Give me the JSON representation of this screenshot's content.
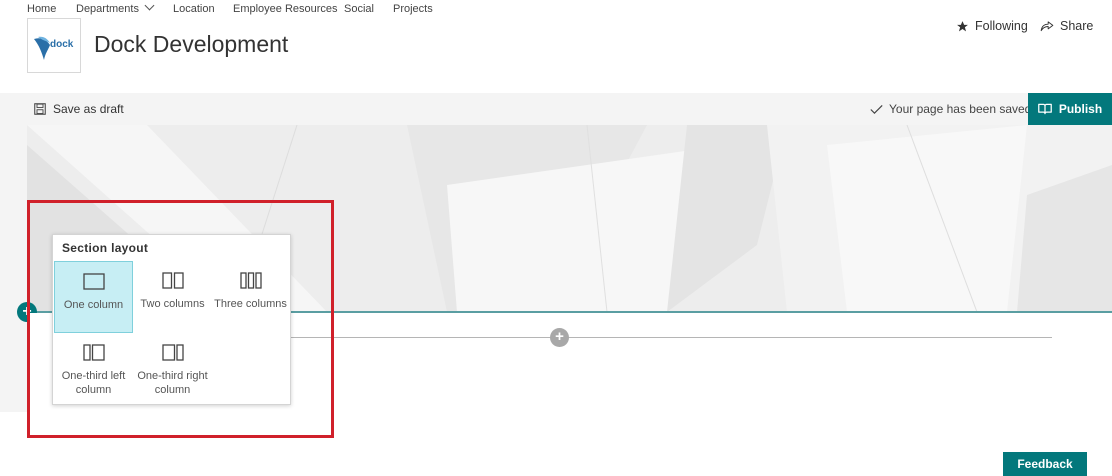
{
  "topnav": {
    "items": [
      "Home",
      "Departments",
      "Location",
      "Employee Resources",
      "Social",
      "Projects"
    ]
  },
  "header": {
    "logo_text": "dock",
    "site_title": "Dock Development",
    "following_label": "Following",
    "share_label": "Share"
  },
  "commandbar": {
    "save_draft_label": "Save as draft",
    "status_text": "Your page has been saved",
    "publish_label": "Publish"
  },
  "section_layout": {
    "title": "Section layout",
    "options": [
      "One column",
      "Two columns",
      "Three columns",
      "One-third left column",
      "One-third right column"
    ],
    "selected": "One column"
  },
  "feedback_label": "Feedback",
  "colors": {
    "accent": "#03787c",
    "highlight_border": "#d0202a",
    "selected_option": "#c7eef4"
  }
}
